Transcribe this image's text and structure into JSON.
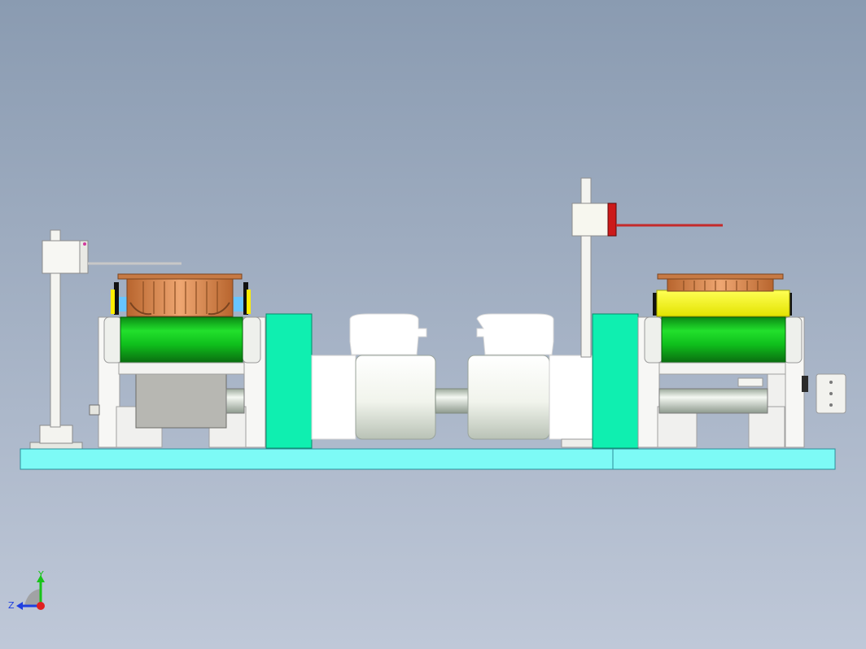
{
  "viewport": {
    "background_top": "#8a9bb1",
    "background_bottom": "#bfc8d8"
  },
  "triad": {
    "y_label": "Y",
    "z_label": "Z",
    "colors": {
      "y_axis": "#19c319",
      "z_axis": "#1f3fe0",
      "x_axis": "#e02020"
    }
  },
  "palette": {
    "base_plate": "#7dfaf6",
    "roller": "#0fbf1c",
    "bracket": "#0fefb0",
    "frame": "#f2f2f2",
    "copper": "#d9864e",
    "cover": "#ffff22",
    "sensor_red": "#cc1a1a",
    "gray_panel": "#b7b7b2"
  }
}
